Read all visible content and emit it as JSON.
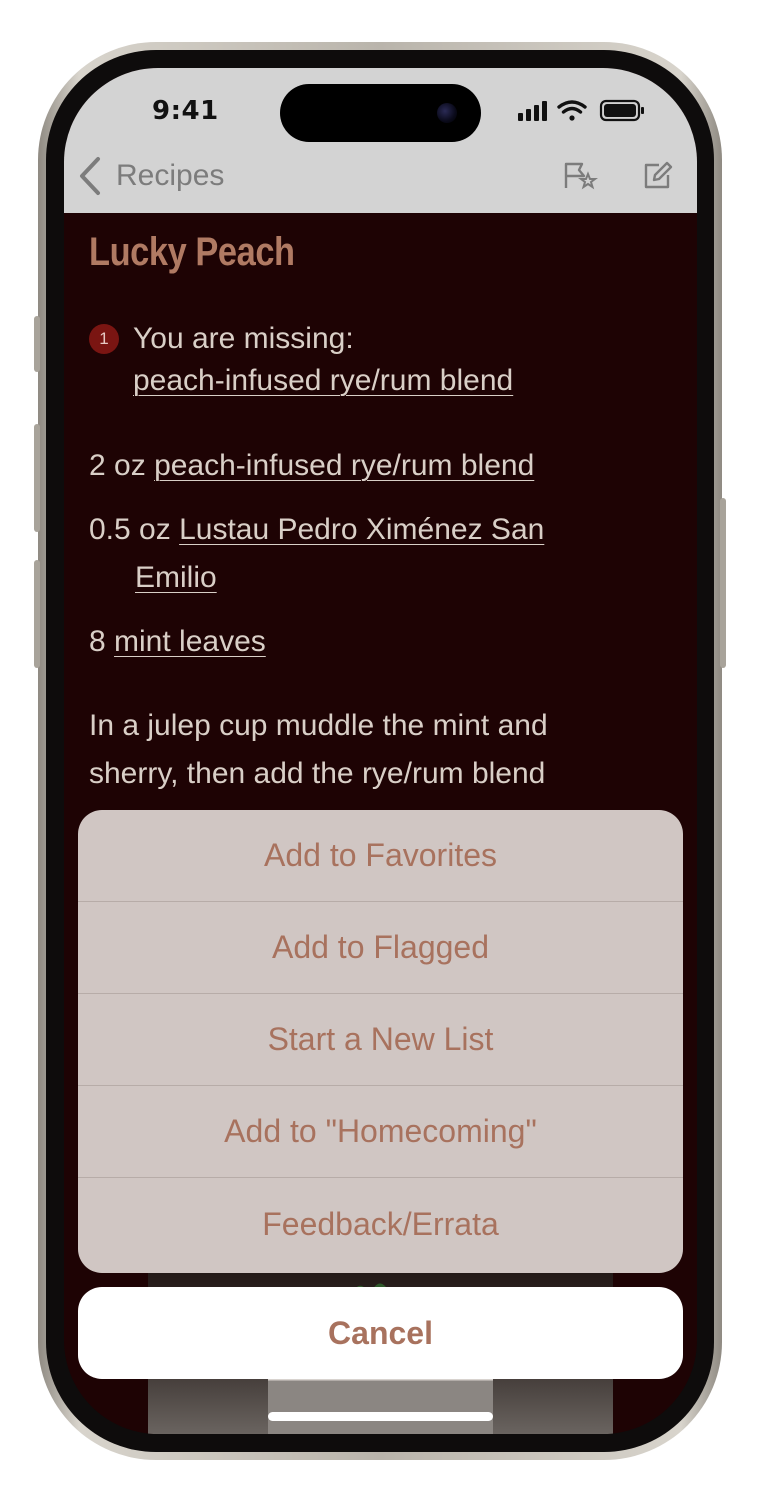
{
  "status_bar": {
    "time": "9:41"
  },
  "nav": {
    "back_label": "Recipes"
  },
  "recipe": {
    "title": "Lucky Peach",
    "missing_count": "1",
    "missing_label": "You are missing:",
    "missing_item": "peach-infused rye/rum blend",
    "ingredients": [
      {
        "amount": "2 oz",
        "name": "peach-infused rye/rum blend"
      },
      {
        "amount": "0.5 oz",
        "name_line1": "Lustau Pedro Ximénez San",
        "name_line2": "Emilio"
      },
      {
        "amount": "8",
        "name": "mint leaves"
      }
    ],
    "instructions_line1": "In a julep cup muddle the mint and",
    "instructions_line2": "sherry, then add the rye/rum blend"
  },
  "action_sheet": {
    "items": [
      "Add to Favorites",
      "Add to Flagged",
      "Start a New List",
      "Add to \"Homecoming\"",
      "Feedback/Errata"
    ],
    "cancel_label": "Cancel"
  },
  "colors": {
    "accent": "#a8725e",
    "title": "#b07a63",
    "background": "#1e0304",
    "badge": "#7a1512"
  },
  "icons": [
    "chevron-left-icon",
    "flag-star-icon",
    "compose-icon",
    "signal-icon",
    "wifi-icon",
    "battery-icon"
  ]
}
